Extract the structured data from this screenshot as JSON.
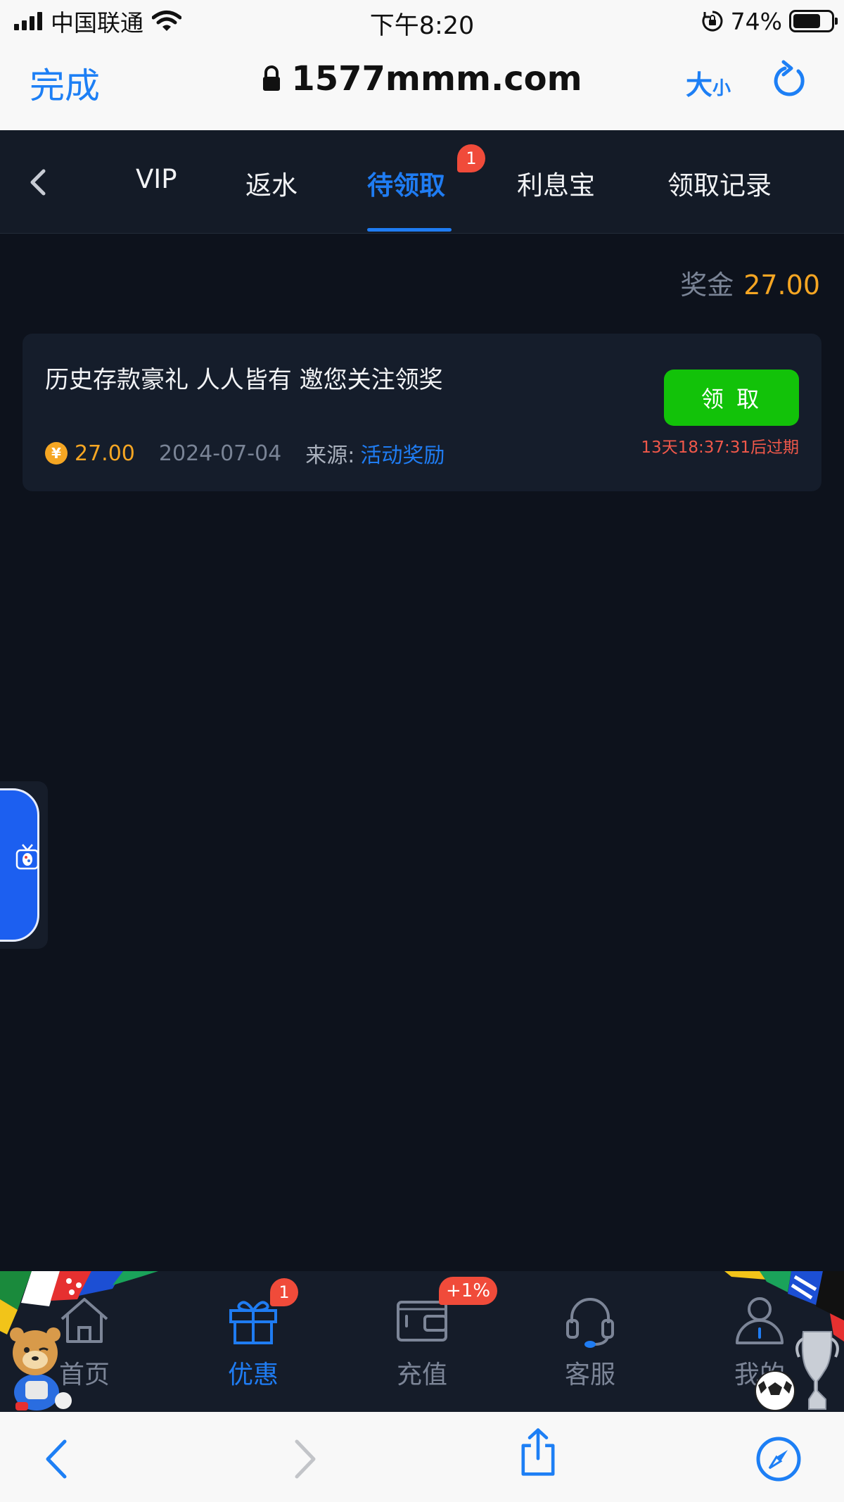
{
  "status_bar": {
    "carrier": "中国联通",
    "time": "下午8:20",
    "battery_pct": "74%",
    "battery_level": 0.74
  },
  "browser": {
    "done_label": "完成",
    "url": "1577mmm.com",
    "textsize_big": "大",
    "textsize_small": "小"
  },
  "tabs": [
    {
      "label": "VIP"
    },
    {
      "label": "返水"
    },
    {
      "label": "待领取",
      "badge": "1"
    },
    {
      "label": "利息宝"
    },
    {
      "label": "领取记录"
    }
  ],
  "bonus": {
    "label": "奖金",
    "value": "27.00"
  },
  "card": {
    "title": "历史存款豪礼 人人皆有 邀您关注领奖",
    "coin_symbol": "¥",
    "amount": "27.00",
    "date": "2024-07-04",
    "source_label": "来源:",
    "source_value": "活动奖励",
    "claim_label": "领 取",
    "expire": "13天18:37:31后过期"
  },
  "bottom_nav": [
    {
      "label": "首页"
    },
    {
      "label": "优惠",
      "badge": "1"
    },
    {
      "label": "充值",
      "badge": "+1%"
    },
    {
      "label": "客服"
    },
    {
      "label": "我的"
    }
  ],
  "colors": {
    "accent": "#1f7cf2",
    "claim_green": "#12c209",
    "gold": "#f6a623",
    "badge_red": "#f04b3a",
    "background": "#0d121c"
  }
}
